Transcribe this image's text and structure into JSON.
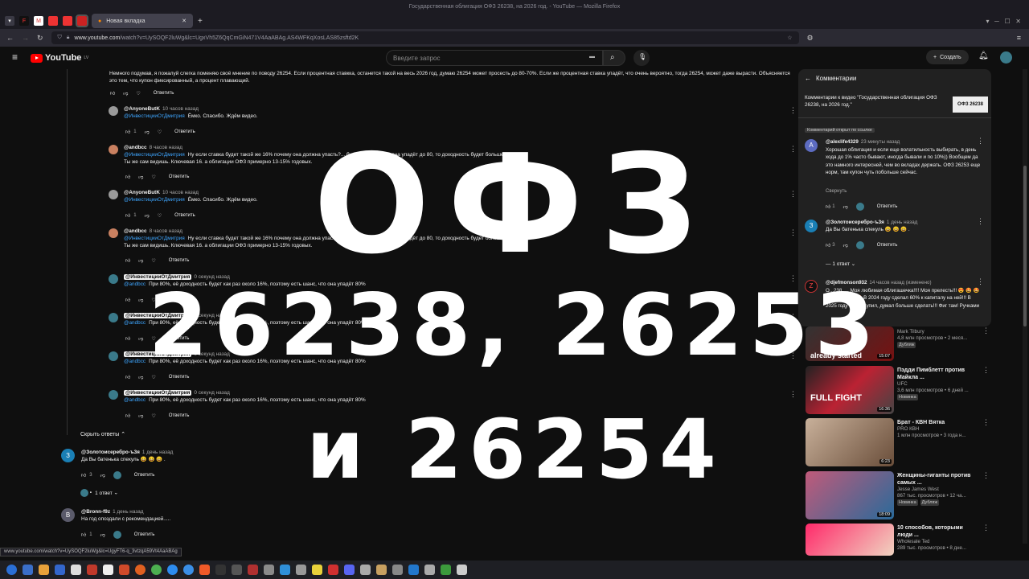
{
  "window_title": "Государственная облигация ОФЗ 26238, на 2026 год. - YouTube — Mozilla Firefox",
  "tab_title": "Новая вкладка",
  "url_prefix": "www.youtube.com",
  "url_path": "/watch?v=UySOQF2luWg&lc=UgxVh5Z6QqCmGiN471V4AaABAg.AS4WFKqXosLAS85zsftd2K",
  "youtube": {
    "logo": "YouTube",
    "country": "LV",
    "search_placeholder": "Введите запрос",
    "create": "Создать"
  },
  "top_comment": "Немного подумав, я пожалуй слегка поменяю своё мнение по поводу 26254. Если процентная ставкка, останется такой на весь 2026 год, думаю 26254 может просесть до 80-70%. Если же процентная ставка упадёт, что очень вероятно, тогда 26254, может даже вырасти. Объясняется это тем, что купон фиксированный, а процент плавающий.",
  "reply_label": "Ответить",
  "replies": [
    {
      "user": "@AnyoneButK",
      "time": "10 часов назад",
      "mention": "@ИнвестицииОтДмитрия",
      "text": "Ёмко. Спасибо. Ждём видео.",
      "likes": "1",
      "av": "#9a9a9a"
    },
    {
      "user": "@andbcc",
      "time": "8 часов назад",
      "mention": "@ИнвестицииОтДмитрия",
      "text": "Ну если ставка будет  такой же 16%  почему она должна упасть?... будет такого, если она упадёт до 80, то доходность будет больше 20%",
      "line2": "Ты же сам видишь.  Ключевая 16. а облигации ОФЗ примерно  13-15%  годовых.",
      "likes": "",
      "av": "#c98060"
    },
    {
      "user": "@AnyoneButK",
      "time": "10 часов назад",
      "mention": "@ИнвестицииОтДмитрия",
      "text": "Ёмко. Спасибо. Ждём видео.",
      "likes": "1",
      "av": "#9a9a9a"
    },
    {
      "user": "@andbcc",
      "time": "8 часов назад",
      "mention": "@ИнвестицииОтДмитрия",
      "text": "Ну если ставка будет  такой же 16%  почему она должна упасть?... будет такого, если она упадёт до 80, то доходность будет больше 20%",
      "line2": "Ты же сам видишь.  Ключевая 16. а облигации ОФЗ примерно  13-15%  годовых.",
      "likes": "",
      "av": "#c98060"
    },
    {
      "user": "@ИнвестицииОтДмитрия",
      "time": "0 секунд назад",
      "mention": "@andbcc",
      "text": "При 80%, её доходность будет как раз около 16%, поэтому есть шанс, что она упадёт 80%",
      "likes": "",
      "av": "#3a7a8a"
    },
    {
      "user": "@ИнвестицииОтДмитрия",
      "time": "0 секунд назад",
      "mention": "@andbcc",
      "text": "При 80%, её доходность будет как раз около 16%, поэтому есть шанс, что она упадёт 80%",
      "likes": "",
      "av": "#3a7a8a"
    },
    {
      "user": "@ИнвестицииОтДмитрия",
      "time": "0 секунд назад",
      "mention": "@andbcc",
      "text": "При 80%, её доходность будет как раз около 16%, поэтому есть шанс, что она упадёт 80%",
      "likes": "",
      "av": "#3a7a8a"
    },
    {
      "user": "@ИнвестицииОтДмитрия",
      "time": "0 секунд назад",
      "mention": "@andbcc",
      "text": "При 80%, её доходность будет как раз около 16%, поэтому есть шанс, что она упадёт 80%",
      "likes": "",
      "av": "#3a7a8a"
    }
  ],
  "hide_replies": "Скрыть ответы",
  "lower_comments": [
    {
      "user": "@Золотоисеребро-ъ3я",
      "time": "1 день назад",
      "text": "Да Вы батенька спекуль 😄 😄 😄 .",
      "likes": "3",
      "initial": "З",
      "av": "#1a7fb5",
      "replies": "1 ответ"
    },
    {
      "user": "@Bronn-f9z",
      "time": "1 день назад",
      "text": "На год опоздали с рекомендацией.....",
      "likes": "1",
      "initial": "B",
      "av": "#5a5a6a"
    }
  ],
  "panel": {
    "title": "Комментарии",
    "video_line": "Комментарии к видео \"Государственная облигация ОФЗ 26238, на 2026 год.\"",
    "thumb_label": "ОФЗ 26238",
    "link_badge": "Комментарий открыт по ссылке",
    "c1_user": "@alexlife4329",
    "c1_time": "23 минуты назад",
    "c1_text": "Хорошая облигация и если еще волатильность выбирать, в день хода до 1% часто бывают, иногда бывали и по 10%)) Вообщем да это намного интересней, чем во вкладах держать. ОФЗ 26253 еще норм, там купон чуть побольше сейчас.",
    "collapse": "Свернуть",
    "c1_likes": "1",
    "c2_user": "@Золотоисеребро-ъ3я",
    "c2_time": "1 день назад",
    "c2_text": "Да Вы батенька спекуль 😄 😄 😄 .",
    "c2_likes": "3",
    "c2_replies": "1 ответ",
    "c3_user": "@djefmonson932",
    "c3_time": "14 часов назад (изменено)",
    "c3_text": "О...238 .... Моя любимая облигашечка!!!! Моя прелесть!!! 😍 🤩 🤩 🤩 🤩 🤩 🤩 🤩 В 2024 году сделал 60% к капиталу на ней!!! В 2025 году снова купил, думал больше сделать!!! Фиг там! Ручками"
  },
  "videos": [
    {
      "title": "",
      "channel": "Mark Tilbury",
      "meta": "4,8 млн просмотров • 2 меся...",
      "badge": "Дубляж",
      "dur": "15:07",
      "ttext": "already started"
    },
    {
      "title": "Пэдди Пимблетт против Майкла ...",
      "channel": "UFC",
      "meta": "3,6 млн просмотров • 6 дней ...",
      "badge": "Новинка",
      "dur": "16:36",
      "ttext": "FULL FIGHT"
    },
    {
      "title": "Брат - КВН Вятка",
      "channel": "PRO КВН",
      "meta": "1 млн просмотров • 3 года н...",
      "badge": "",
      "dur": "6:23",
      "ttext": ""
    },
    {
      "title": "Женщины-гиганты против самых ...",
      "channel": "Jesse James West",
      "meta": "867 тыс. просмотров • 12 ча...",
      "badge": "Новинка",
      "badge2": "Дубляж",
      "dur": "18:09",
      "ttext": ""
    },
    {
      "title": "10 способов, которыми люди ...",
      "channel": "Wholesale Ted",
      "meta": "289 тыс. просмотров • 8 дне...",
      "badge": "",
      "dur": "",
      "ttext": ""
    }
  ],
  "overlay": {
    "line1": "ОФЗ",
    "line2": "26238, 26253",
    "line3": "и 26254"
  },
  "status_url": "www.youtube.com/watch?v=UySOQF2luWg&lc=UgyFT6-q_3vtzqA59Vt4AaABAg"
}
